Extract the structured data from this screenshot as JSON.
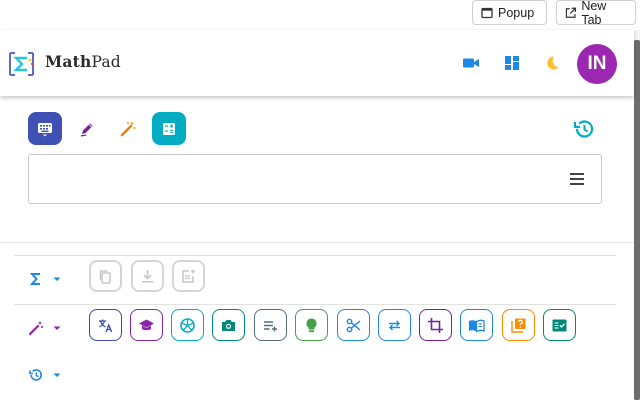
{
  "window": {
    "popup_label": "Popup",
    "newtab_label": "New Tab"
  },
  "header": {
    "brand_bold": "Math",
    "brand_rest": "Pad",
    "avatar_initials": "IN",
    "avatar_color": "#9c27b0",
    "icons": [
      "video-camera-icon",
      "dashboard-icon",
      "dark-mode-moon-icon"
    ]
  },
  "modes": {
    "items": [
      "keyboard-mode",
      "handwriting-mode",
      "magic-wand-mode",
      "calculator-mode"
    ],
    "active_colors": {
      "keyboard": "#3f51b5",
      "calculator": "#00acc1"
    }
  },
  "editor": {
    "value": ""
  },
  "panel": {
    "rows": [
      "sigma-row",
      "magic-row",
      "history-row"
    ],
    "sigma_tools": [
      "copy",
      "download",
      "insert"
    ],
    "magic_tools": [
      "translate",
      "learn",
      "aperture",
      "camera",
      "playlist-add",
      "hint",
      "scissors",
      "swap",
      "crop",
      "read",
      "quiz",
      "checklist"
    ]
  }
}
